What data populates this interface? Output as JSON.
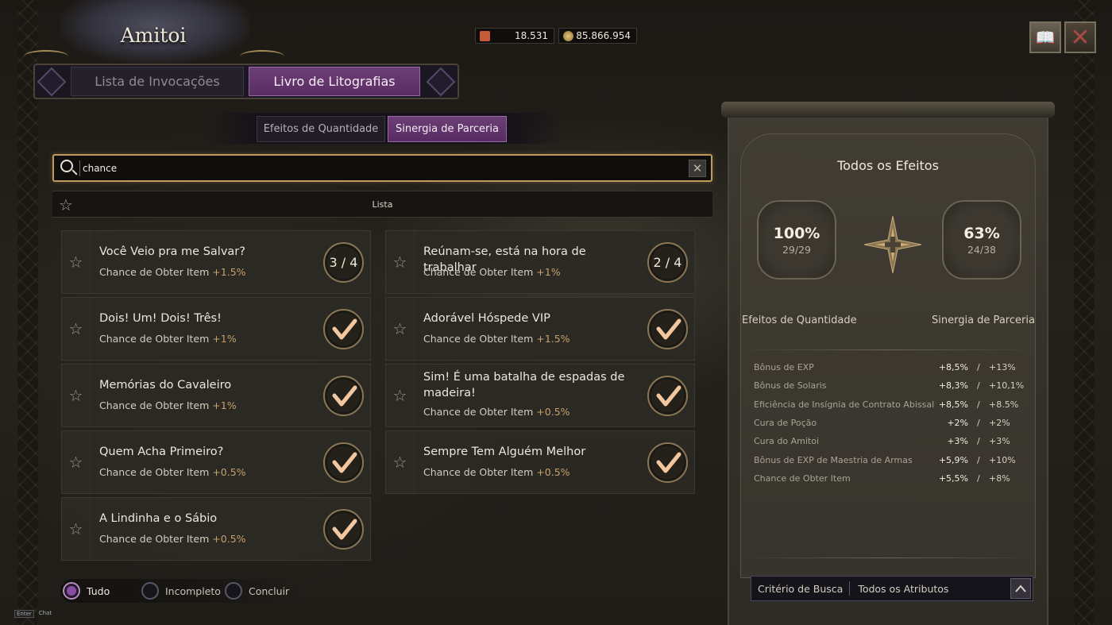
{
  "header": {
    "title": "Amitoi",
    "currency_1": "18.531",
    "currency_2": "85.866.954"
  },
  "main_tabs": [
    {
      "label": "Lista de Invocações",
      "active": false
    },
    {
      "label": "Livro de Litografias",
      "active": true
    }
  ],
  "sub_tabs": [
    {
      "label": "Efeitos de Quantidade",
      "active": false
    },
    {
      "label": "Sinergia de Parceria",
      "active": true
    }
  ],
  "search": {
    "value": "chance"
  },
  "list_header": "Lista",
  "cards": [
    {
      "name": "Você Veio pra me Salvar?",
      "effect": "Chance de Obter Item",
      "value": "+1.5%",
      "progress": "3 / 4",
      "complete": false
    },
    {
      "name": "Reúnam-se, está na hora de trabalhar",
      "effect": "Chance de Obter Item",
      "value": "+1%",
      "progress": "2 / 4",
      "complete": false
    },
    {
      "name": "Dois! Um! Dois! Três!",
      "effect": "Chance de Obter Item",
      "value": "+1%",
      "complete": true
    },
    {
      "name": "Adorável Hóspede VIP",
      "effect": "Chance de Obter Item",
      "value": "+1.5%",
      "complete": true
    },
    {
      "name": "Memórias do Cavaleiro",
      "effect": "Chance de Obter Item",
      "value": "+1%",
      "complete": true
    },
    {
      "name": "Sim! É uma batalha de espadas de madeira!",
      "effect": "Chance de Obter Item",
      "value": "+0.5%",
      "complete": true
    },
    {
      "name": "Quem Acha Primeiro?",
      "effect": "Chance de Obter Item",
      "value": "+0.5%",
      "complete": true
    },
    {
      "name": "Sempre Tem Alguém Melhor",
      "effect": "Chance de Obter Item",
      "value": "+0.5%",
      "complete": true
    },
    {
      "name": "A Lindinha e o Sábio",
      "effect": "Chance de Obter Item",
      "value": "+0.5%",
      "complete": true
    }
  ],
  "filters": [
    {
      "label": "Tudo",
      "selected": true
    },
    {
      "label": "Incompleto",
      "selected": false
    },
    {
      "label": "Concluir",
      "selected": false
    }
  ],
  "hint": {
    "key": "Enter",
    "label": "Chat"
  },
  "panel": {
    "title": "Todos os Efeitos",
    "left": {
      "percent": "100%",
      "count": "29/29",
      "label": "Efeitos de Quantidade"
    },
    "right": {
      "percent": "63%",
      "count": "24/38",
      "label": "Sinergia de Parceria"
    },
    "stats": [
      {
        "name": "Bônus de EXP",
        "a": "+8,5%",
        "sep": "/",
        "b": "+13%"
      },
      {
        "name": "Bônus de Solaris",
        "a": "+8,3%",
        "sep": "/",
        "b": "+10,1%"
      },
      {
        "name": "Eficiência de Insígnia de Contrato Abissal",
        "a": "+8,5%",
        "sep": "/",
        "b": "+8.5%"
      },
      {
        "name": "Cura de Poção",
        "a": "+2%",
        "sep": "/",
        "b": "+2%"
      },
      {
        "name": "Cura do Amitoi",
        "a": "+3%",
        "sep": "/",
        "b": "+3%"
      },
      {
        "name": "Bônus de EXP de Maestria de Armas",
        "a": "+5,9%",
        "sep": "/",
        "b": "+10%"
      },
      {
        "name": "Chance de Obter Item",
        "a": "+5,5%",
        "sep": "/",
        "b": "+8%"
      }
    ],
    "criteria_label": "Critério de Busca",
    "criteria_value": "Todos os Atributos"
  },
  "colors": {
    "accent_purple": "#6c3e76",
    "gold": "#c9a06a",
    "check_fill": "#f3c7a0"
  }
}
